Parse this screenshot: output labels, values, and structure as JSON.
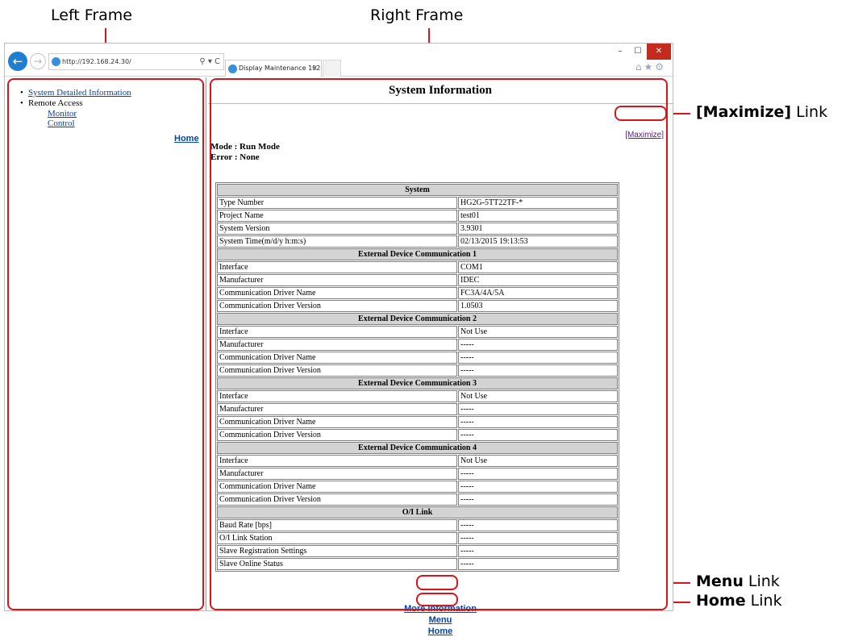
{
  "annotations": {
    "left_frame": "Left Frame",
    "right_frame": "Right Frame",
    "maximize_bold": "[Maximize]",
    "maximize_rest": " Link",
    "menu_bold": "Menu",
    "menu_rest": " Link",
    "home_bold": "Home",
    "home_rest": " Link"
  },
  "browser": {
    "address": "http://192.168.24.30/",
    "address_tools": "⚲ ▾ C",
    "tab_title": "Display Maintenance 192.16...",
    "tab_close": "×",
    "win_min": "–",
    "win_max": "☐",
    "win_close": "✕",
    "tool_icons": "⌂★⚙"
  },
  "left_frame": {
    "system_detailed": "System Detailed Information",
    "remote_access": "Remote Access",
    "monitor": "Monitor",
    "control": "Control",
    "home": "Home"
  },
  "right_frame": {
    "title": "System Information",
    "maximize": "[Maximize]",
    "mode": "Mode : Run Mode",
    "error": "Error : None",
    "more_info": "More Information",
    "menu": "Menu",
    "home": "Home"
  },
  "table": {
    "system": {
      "header": "System",
      "rows": [
        [
          "Type Number",
          "HG2G-5TT22TF-*"
        ],
        [
          "Project Name",
          "test01"
        ],
        [
          "System Version",
          "3.9301"
        ],
        [
          "System Time(m/d/y h:m:s)",
          "02/13/2015 19:13:53"
        ]
      ]
    },
    "ext1": {
      "header": "External Device Communication 1",
      "rows": [
        [
          "Interface",
          "COM1"
        ],
        [
          "Manufacturer",
          "IDEC"
        ],
        [
          "Communication Driver Name",
          "FC3A/4A/5A"
        ],
        [
          "Communication Driver Version",
          "1.0503"
        ]
      ]
    },
    "ext2": {
      "header": "External Device Communication 2",
      "rows": [
        [
          "Interface",
          "Not Use"
        ],
        [
          "Manufacturer",
          "-----"
        ],
        [
          "Communication Driver Name",
          "-----"
        ],
        [
          "Communication Driver Version",
          "-----"
        ]
      ]
    },
    "ext3": {
      "header": "External Device Communication 3",
      "rows": [
        [
          "Interface",
          "Not Use"
        ],
        [
          "Manufacturer",
          "-----"
        ],
        [
          "Communication Driver Name",
          "-----"
        ],
        [
          "Communication Driver Version",
          "-----"
        ]
      ]
    },
    "ext4": {
      "header": "External Device Communication 4",
      "rows": [
        [
          "Interface",
          "Not Use"
        ],
        [
          "Manufacturer",
          "-----"
        ],
        [
          "Communication Driver Name",
          "-----"
        ],
        [
          "Communication Driver Version",
          "-----"
        ]
      ]
    },
    "oilink": {
      "header": "O/I Link",
      "rows": [
        [
          "Baud Rate [bps]",
          "-----"
        ],
        [
          "O/I Link Station",
          "-----"
        ],
        [
          "Slave Registration Settings",
          "-----"
        ],
        [
          "Slave Online Status",
          "-----"
        ]
      ]
    }
  },
  "colors": {
    "annotation_red": "#d9141b",
    "link_blue": "#0645ad",
    "header_gray": "#d3d3d3"
  }
}
